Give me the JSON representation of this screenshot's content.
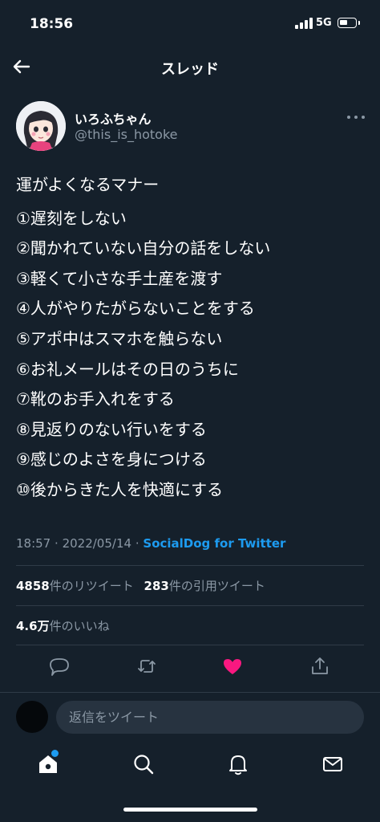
{
  "status_bar": {
    "time": "18:56",
    "network": "5G"
  },
  "nav": {
    "title": "スレッド"
  },
  "author": {
    "name": "いろふちゃん",
    "handle": "@this_is_hotoke"
  },
  "tweet": {
    "heading": "運がよくなるマナー",
    "lines": [
      "①遅刻をしない",
      "②聞かれていない自分の話をしない",
      "③軽くて小さな手土産を渡す",
      "④人がやりたがらないことをする",
      "⑤アポ中はスマホを触らない",
      "⑥お礼メールはその日のうちに",
      "⑦靴のお手入れをする",
      "⑧見返りのない行いをする",
      "⑨感じのよさを身につける",
      "⑩後からきた人を快適にする"
    ]
  },
  "meta": {
    "time": "18:57",
    "separator": "·",
    "date": "2022/05/14",
    "source": "SocialDog for Twitter"
  },
  "stats": {
    "retweet_count": "4858",
    "retweet_label": "件のリツイート",
    "quote_count": "283",
    "quote_label": "件の引用ツイート",
    "like_count": "4.6万",
    "like_label": "件のいいね"
  },
  "actions": {
    "reply_icon": "reply-icon",
    "retweet_icon": "retweet-icon",
    "like_icon": "heart-icon",
    "share_icon": "share-icon",
    "like_color": "#f91880"
  },
  "reply": {
    "placeholder": "返信をツイート"
  },
  "tabbar": {
    "items": [
      "home-icon",
      "search-icon",
      "notifications-icon",
      "messages-icon"
    ],
    "accent": "#1d9bf0"
  }
}
